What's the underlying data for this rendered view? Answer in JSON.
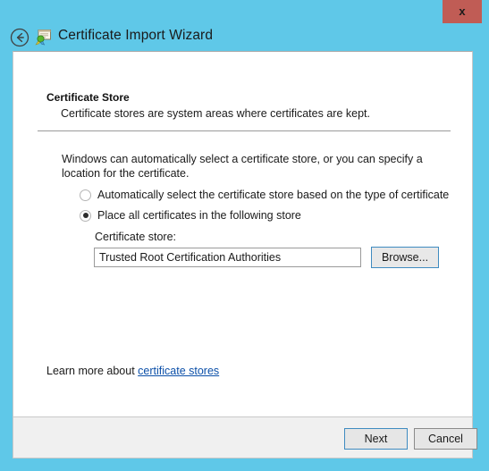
{
  "window": {
    "title": "Certificate Import Wizard",
    "close_label": "x",
    "back_icon": "back-arrow-icon",
    "title_icon": "certificate-icon",
    "frame_color": "#5FC8E8",
    "close_color": "#C05C55"
  },
  "page": {
    "heading": "Certificate Store",
    "subheading": "Certificate stores are system areas where certificates are kept.",
    "body": "Windows can automatically select a certificate store, or you can specify a location for the certificate."
  },
  "options": {
    "auto": {
      "label": "Automatically select the certificate store based on the type of certificate",
      "checked": false
    },
    "place": {
      "label": "Place all certificates in the following store",
      "checked": true
    }
  },
  "store_field": {
    "label": "Certificate store:",
    "value": "Trusted Root Certification Authorities",
    "browse_label": "Browse..."
  },
  "learn_more": {
    "prefix": "Learn more about ",
    "link_text": "certificate stores",
    "link_color": "#0B4FA8"
  },
  "footer": {
    "next_label": "Next",
    "cancel_label": "Cancel"
  }
}
